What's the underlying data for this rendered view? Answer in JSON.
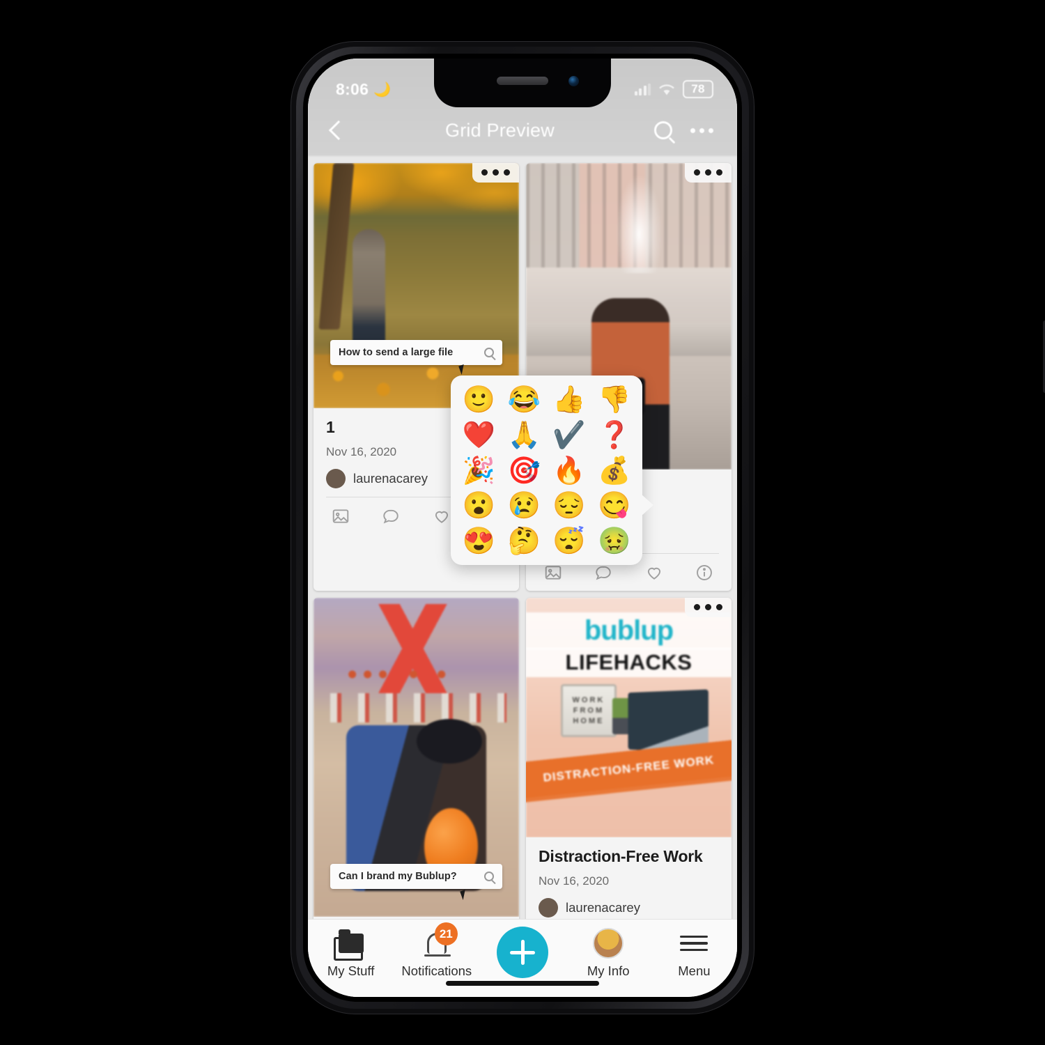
{
  "theme": {
    "ring_gradient_from": "#F5912F",
    "ring_gradient_to": "#FCC155",
    "accent_cyan": "#17B2CE",
    "badge_orange": "#ED7023",
    "brand_teal": "#21B5C9"
  },
  "status_bar": {
    "time": "8:06",
    "moon_icon": "moon-icon",
    "signal_icon": "cellular-bars-icon",
    "wifi_icon": "wifi-icon",
    "battery": "78"
  },
  "nav": {
    "back_icon": "chevron-left-icon",
    "title": "Grid Preview",
    "search_icon": "search-icon",
    "more_icon": "more-horizontal-icon"
  },
  "cards": [
    {
      "id": "autumn-lake",
      "menu_icon": "more-horizontal-icon",
      "search_overlay": {
        "value": "How to send a large file",
        "icon": "search-icon"
      },
      "title": "1",
      "date": "Nov 16, 2020",
      "user": "laurenacarey",
      "actions": [
        "image-icon",
        "comment-icon",
        "heart-icon",
        "info-icon"
      ]
    },
    {
      "id": "plaza-camera",
      "menu_icon": "more-horizontal-icon"
    },
    {
      "id": "bowling-alley",
      "menu_icon": "more-horizontal-icon",
      "search_overlay": {
        "value": "Can I brand my Bublup?",
        "icon": "search-icon"
      }
    },
    {
      "id": "lifehacks",
      "menu_icon": "more-horizontal-icon",
      "brand": "bublup",
      "subtitle": "LIFEHACKS",
      "board_lines": [
        "WORK",
        "FROM",
        "HOME"
      ],
      "banner": "DISTRACTION-FREE WORK",
      "title": "Distraction-Free Work",
      "date": "Nov 16, 2020",
      "user": "laurenacarey"
    }
  ],
  "emoji_picker": {
    "name": "reaction-picker",
    "columns": 4,
    "items": [
      {
        "glyph": "🙂",
        "name": "emoji-slightly-smiling-face"
      },
      {
        "glyph": "😂",
        "name": "emoji-face-with-tears-of-joy"
      },
      {
        "glyph": "👍",
        "name": "emoji-thumbs-up"
      },
      {
        "glyph": "👎",
        "name": "emoji-thumbs-down"
      },
      {
        "glyph": "❤️",
        "name": "emoji-red-heart"
      },
      {
        "glyph": "🙏",
        "name": "emoji-folded-hands"
      },
      {
        "glyph": "✔️",
        "name": "emoji-check-mark"
      },
      {
        "glyph": "❓",
        "name": "emoji-question-mark"
      },
      {
        "glyph": "🎉",
        "name": "emoji-party-popper"
      },
      {
        "glyph": "🎯",
        "name": "emoji-bullseye"
      },
      {
        "glyph": "🔥",
        "name": "emoji-fire"
      },
      {
        "glyph": "💰",
        "name": "emoji-money-bag"
      },
      {
        "glyph": "😮",
        "name": "emoji-face-with-open-mouth"
      },
      {
        "glyph": "😢",
        "name": "emoji-crying-face"
      },
      {
        "glyph": "😔",
        "name": "emoji-pensive-face"
      },
      {
        "glyph": "😋",
        "name": "emoji-face-savoring-food"
      },
      {
        "glyph": "😍",
        "name": "emoji-smiling-face-with-heart-eyes"
      },
      {
        "glyph": "🤔",
        "name": "emoji-thinking-face"
      },
      {
        "glyph": "😴",
        "name": "emoji-sleeping-face"
      },
      {
        "glyph": "🤢",
        "name": "emoji-nauseated-face"
      }
    ]
  },
  "tab_bar": {
    "items": [
      {
        "label": "My Stuff",
        "icon": "folder-icon",
        "badge": null
      },
      {
        "label": "Notifications",
        "icon": "bell-icon",
        "badge": "21"
      },
      {
        "label": "",
        "icon": "plus-icon",
        "badge": null
      },
      {
        "label": "My Info",
        "icon": "avatar-icon",
        "badge": null
      },
      {
        "label": "Menu",
        "icon": "hamburger-icon",
        "badge": null
      }
    ]
  }
}
